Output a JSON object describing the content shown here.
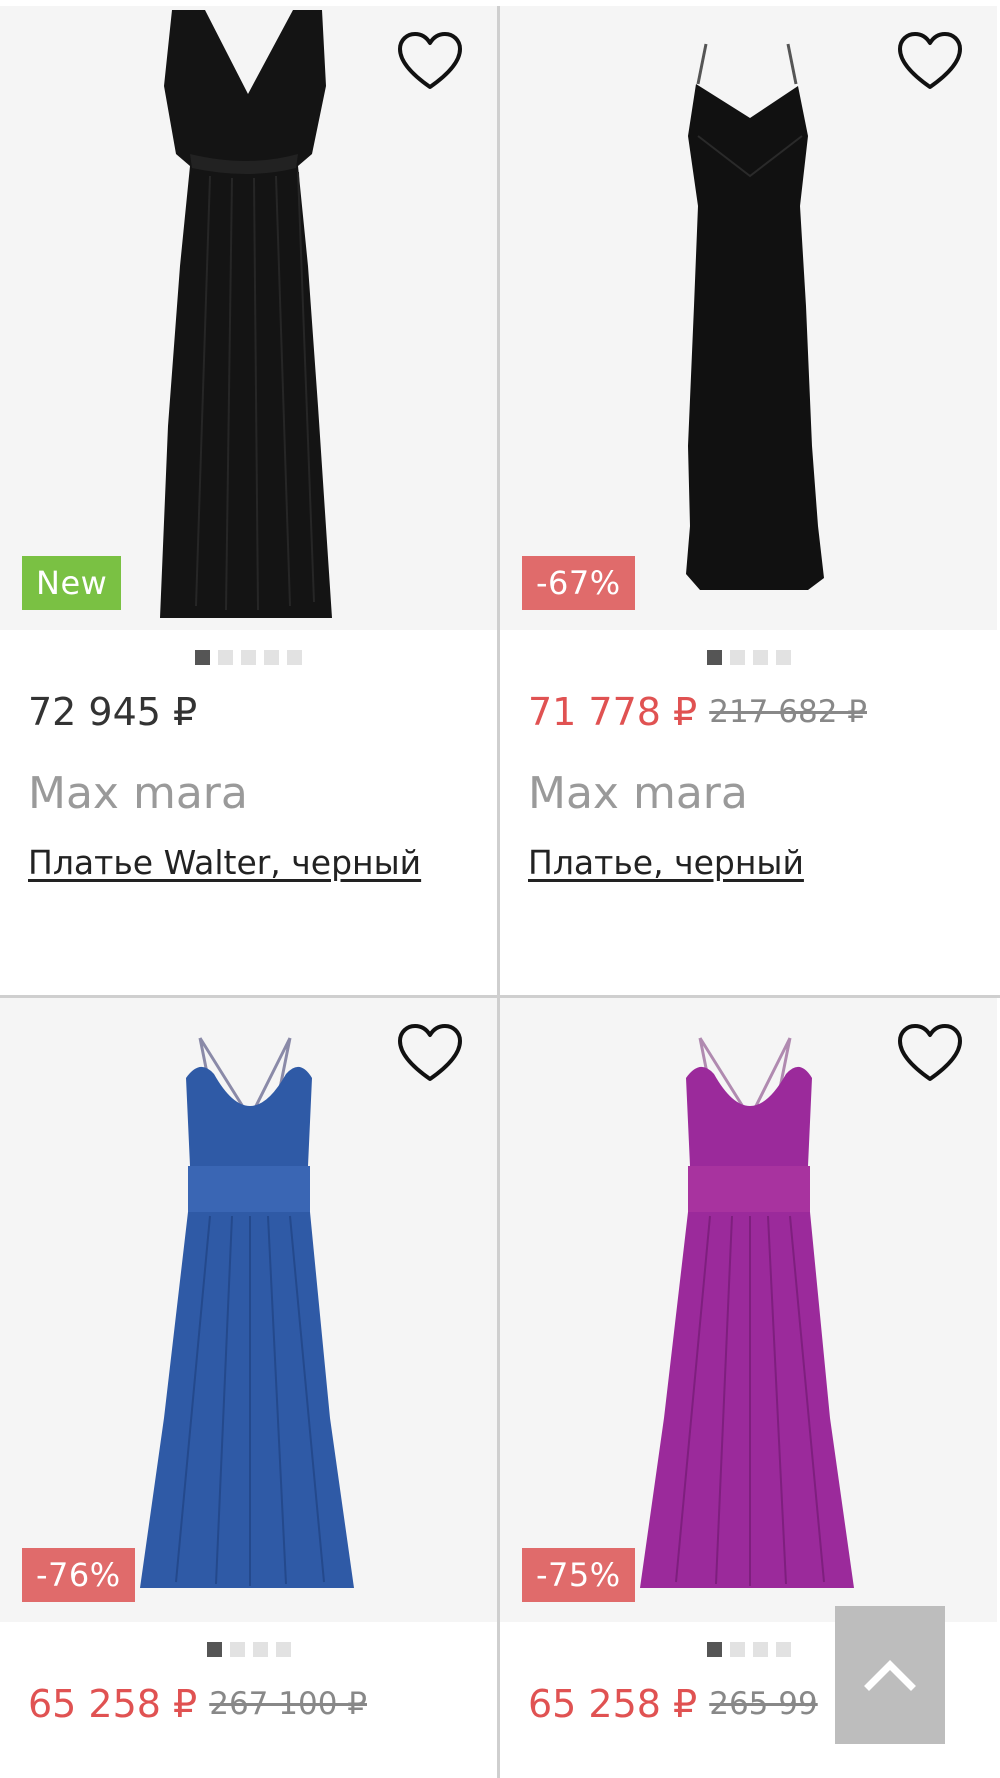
{
  "products": [
    {
      "badge": "New",
      "price": "72 945 ₽",
      "old_price": "",
      "brand": "Max mara",
      "title": "Платье Walter, черный",
      "dots_count": 5,
      "dress_color": "#141414"
    },
    {
      "badge": "-67%",
      "price": "71 778 ₽",
      "old_price": "217 682 ₽",
      "brand": "Max mara",
      "title": "Платье, черный",
      "dots_count": 4,
      "dress_color": "#111111"
    },
    {
      "badge": "-76%",
      "price": "65 258 ₽",
      "old_price": "267 100 ₽",
      "brand": "",
      "title": "",
      "dots_count": 4,
      "dress_color": "#2f5aa6"
    },
    {
      "badge": "-75%",
      "price": "65 258 ₽",
      "old_price": "265 99",
      "brand": "",
      "title": "",
      "dots_count": 4,
      "dress_color": "#9b2a9b"
    }
  ],
  "colors": {
    "sale_price": "#e05252",
    "badge_new": "#7ac143",
    "badge_sale": "#e06b6b",
    "dot_active": "#555555",
    "dot_inactive": "#e2e2e2"
  },
  "icons": {
    "favorite": "heart-outline-icon",
    "scroll_top": "chevron-up-icon"
  }
}
